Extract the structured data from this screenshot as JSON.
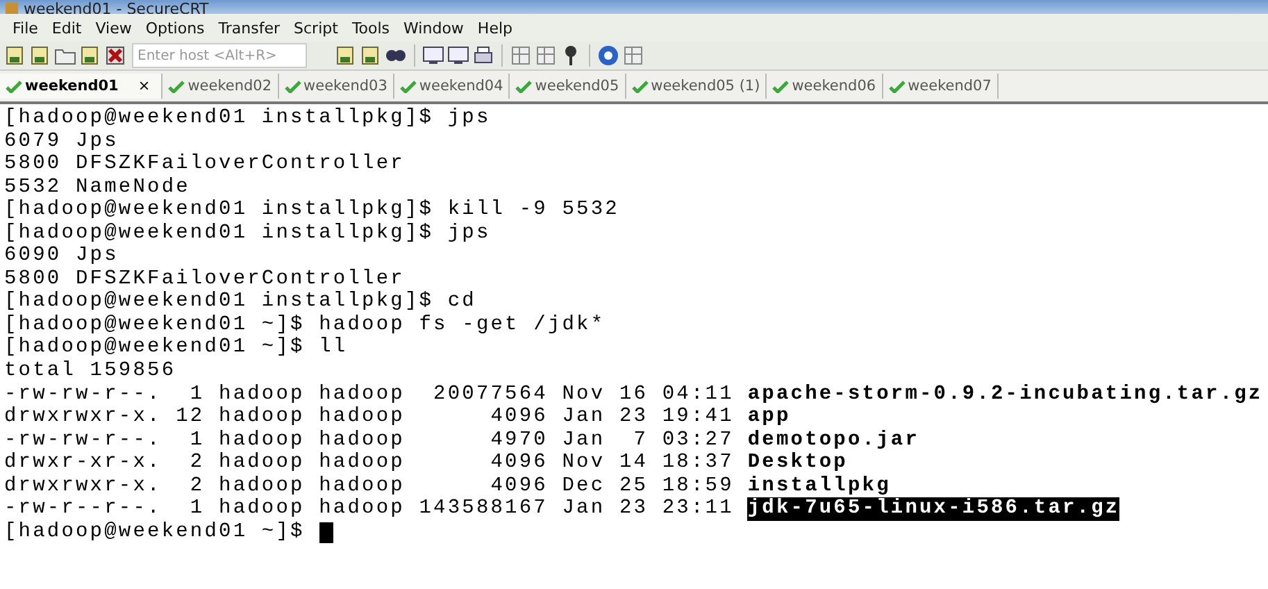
{
  "window": {
    "title": "weekend01 - SecureCRT"
  },
  "menu": [
    "File",
    "Edit",
    "View",
    "Options",
    "Transfer",
    "Script",
    "Tools",
    "Window",
    "Help"
  ],
  "toolbar": {
    "host_field": {
      "placeholder": "Enter host <Alt+R>"
    }
  },
  "tabs": [
    {
      "label": "weekend01",
      "selected": true,
      "connected": true,
      "close": "×"
    },
    {
      "label": "weekend02",
      "selected": false,
      "connected": true
    },
    {
      "label": "weekend03",
      "selected": false,
      "connected": true
    },
    {
      "label": "weekend04",
      "selected": false,
      "connected": true
    },
    {
      "label": "weekend05",
      "selected": false,
      "connected": true
    },
    {
      "label": "weekend05 (1)",
      "selected": false,
      "connected": true
    },
    {
      "label": "weekend06",
      "selected": false,
      "connected": true
    },
    {
      "label": "weekend07",
      "selected": false,
      "connected": true
    }
  ],
  "terminal": {
    "lines": [
      {
        "kind": "text",
        "text": "[hadoop@weekend01 installpkg]$ jps"
      },
      {
        "kind": "text",
        "text": "6079 Jps"
      },
      {
        "kind": "text",
        "text": "5800 DFSZKFailoverController"
      },
      {
        "kind": "text",
        "text": "5532 NameNode"
      },
      {
        "kind": "text",
        "text": "[hadoop@weekend01 installpkg]$ kill -9 5532"
      },
      {
        "kind": "text",
        "text": "[hadoop@weekend01 installpkg]$ jps"
      },
      {
        "kind": "text",
        "text": "6090 Jps"
      },
      {
        "kind": "text",
        "text": "5800 DFSZKFailoverController"
      },
      {
        "kind": "text",
        "text": "[hadoop@weekend01 installpkg]$ cd"
      },
      {
        "kind": "text",
        "text": "[hadoop@weekend01 ~]$ hadoop fs -get /jdk*"
      },
      {
        "kind": "text",
        "text": "[hadoop@weekend01 ~]$ ll"
      },
      {
        "kind": "text",
        "text": "total 159856"
      },
      {
        "kind": "listing",
        "meta": "-rw-rw-r--.  1 hadoop hadoop  20077564 Nov 16 04:11",
        "name": "apache-storm-0.9.2-incubating.tar.gz",
        "selected": false
      },
      {
        "kind": "listing",
        "meta": "drwxrwxr-x. 12 hadoop hadoop      4096 Jan 23 19:41",
        "name": "app",
        "selected": false
      },
      {
        "kind": "listing",
        "meta": "-rw-rw-r--.  1 hadoop hadoop      4970 Jan  7 03:27",
        "name": "demotopo.jar",
        "selected": false
      },
      {
        "kind": "listing",
        "meta": "drwxr-xr-x.  2 hadoop hadoop      4096 Nov 14 18:37",
        "name": "Desktop",
        "selected": false
      },
      {
        "kind": "listing",
        "meta": "drwxrwxr-x.  2 hadoop hadoop      4096 Dec 25 18:59",
        "name": "installpkg",
        "selected": false
      },
      {
        "kind": "listing",
        "meta": "-rw-r--r--.  1 hadoop hadoop 143588167 Jan 23 23:11",
        "name": "jdk-7u65-linux-i586.tar.gz",
        "selected": true
      },
      {
        "kind": "prompt",
        "text": "[hadoop@weekend01 ~]$ ",
        "cursor": true
      }
    ]
  }
}
